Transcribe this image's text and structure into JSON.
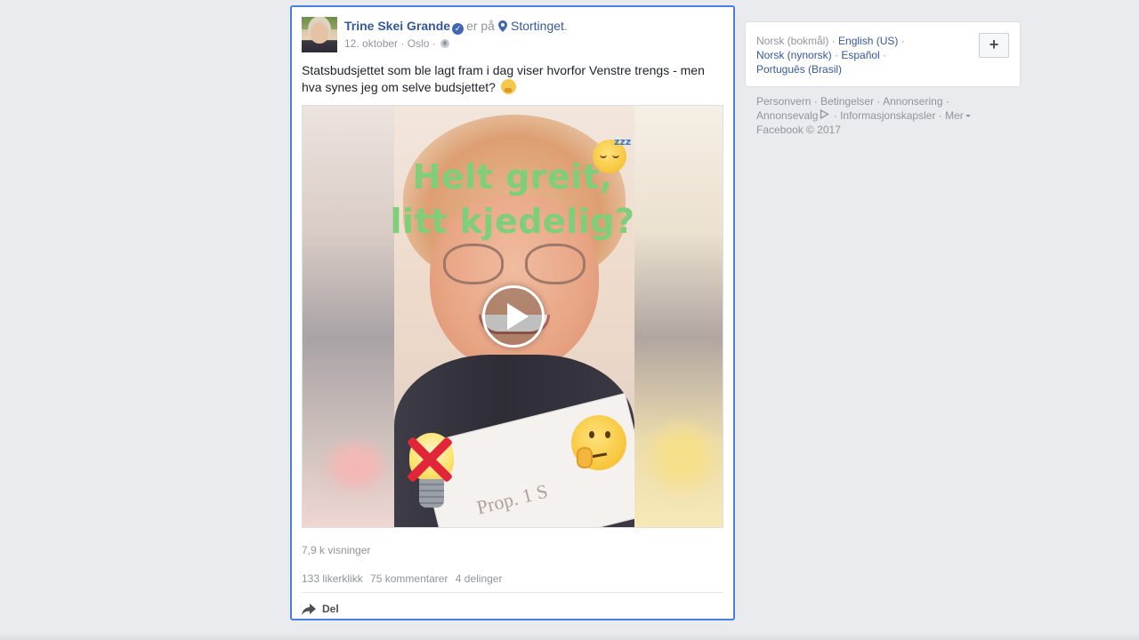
{
  "post": {
    "author": "Trine Skei Grande",
    "at_text": "er på",
    "location": "Stortinget",
    "location_suffix": ".",
    "date": "12. oktober",
    "city": "Oslo",
    "separator": " · ",
    "message": "Statsbudsjettet som ble lagt fram i dag viser hvorfor Venstre trengs - men hva synes jeg om selve budsjettet?",
    "video": {
      "overlay_line1": "Helt greit,",
      "overlay_line2": "litt kjedelig?",
      "paper_text": "Prop. 1 S",
      "sleep_zzz": "zzz"
    },
    "views": "7,9 k visninger",
    "likes": "133 likerklikk",
    "comments": "75 kommentarer",
    "shares": "4 delinger",
    "share_action": "Del"
  },
  "sidebar": {
    "languages": {
      "current": "Norsk (bokmål)",
      "options": [
        "English (US)",
        "Norsk (nynorsk)",
        "Español",
        "Português (Brasil)"
      ],
      "add_label": "+"
    },
    "footer": {
      "links": [
        "Personvern",
        "Betingelser",
        "Annonsering",
        "Annonsevalg",
        "Informasjonskapsler",
        "Mer"
      ],
      "copyright": "Facebook © 2017"
    }
  },
  "colors": {
    "link_blue": "#365899",
    "focus_border": "#4a7ee0",
    "muted_text": "#90949c",
    "overlay_green": "#7fcf7a"
  },
  "icons": {
    "verified": "verified-badge-icon",
    "location": "map-pin-icon",
    "audience": "globe-icon",
    "play": "play-icon",
    "share": "share-arrow-icon",
    "adchoices": "adchoices-icon",
    "more": "caret-down-icon"
  }
}
